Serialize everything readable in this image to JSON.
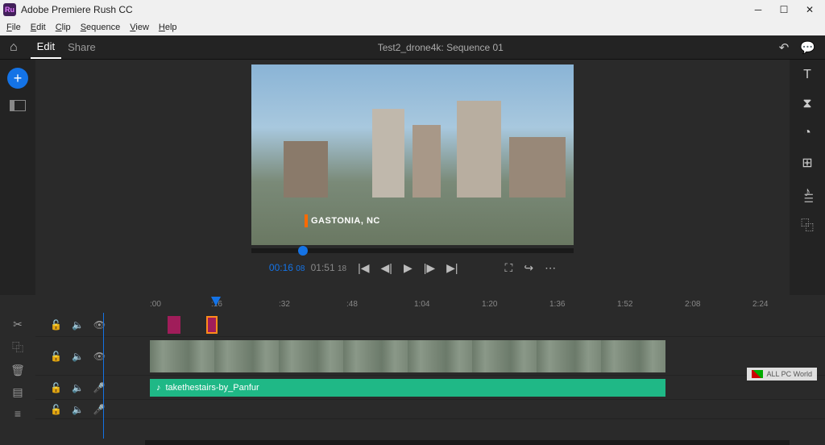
{
  "window": {
    "title": "Adobe Premiere Rush CC",
    "logo_text": "Ru"
  },
  "menu": {
    "items": [
      "File",
      "Edit",
      "Clip",
      "Sequence",
      "View",
      "Help"
    ]
  },
  "header": {
    "tabs": {
      "edit": "Edit",
      "share": "Share"
    },
    "project_title": "Test2_drone4k: Sequence 01"
  },
  "preview": {
    "location_label": "GASTONIA, NC"
  },
  "playback": {
    "current_time": "00:16",
    "current_frames": "08",
    "total_time": "01:51",
    "total_frames": "18"
  },
  "timeline": {
    "ticks": [
      ":00",
      ":16",
      ":32",
      ":48",
      "1:04",
      "1:20",
      "1:36",
      "1:52",
      "2:08",
      "2:24"
    ],
    "audio_clip_label": "takethestairs-by_Panfur"
  },
  "watermark": {
    "text": "ALL PC World"
  }
}
